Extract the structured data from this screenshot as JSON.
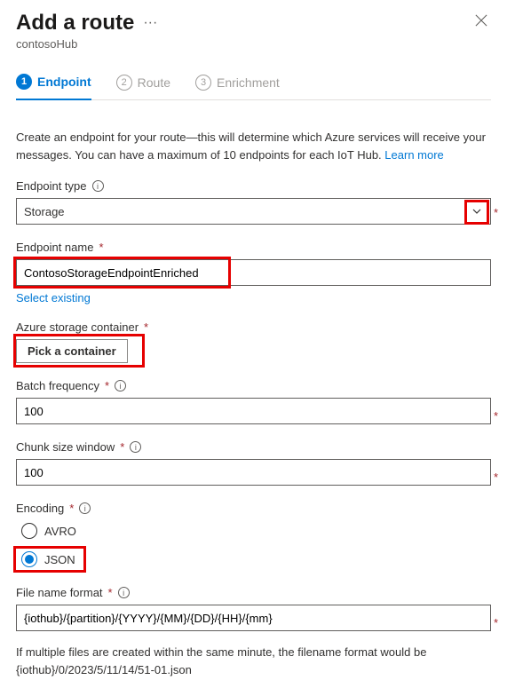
{
  "header": {
    "title": "Add a route",
    "subtitle": "contosoHub"
  },
  "tabs": [
    {
      "num": "1",
      "label": "Endpoint",
      "active": true
    },
    {
      "num": "2",
      "label": "Route",
      "active": false
    },
    {
      "num": "3",
      "label": "Enrichment",
      "active": false
    }
  ],
  "intro": {
    "text": "Create an endpoint for your route—this will determine which Azure services will receive your messages. You can have a maximum of 10 endpoints for each IoT Hub. ",
    "link": "Learn more"
  },
  "fields": {
    "endpointType": {
      "label": "Endpoint type",
      "value": "Storage"
    },
    "endpointName": {
      "label": "Endpoint name",
      "value": "ContosoStorageEndpointEnriched",
      "selectExisting": "Select existing"
    },
    "container": {
      "label": "Azure storage container",
      "button": "Pick a container"
    },
    "batchFreq": {
      "label": "Batch frequency",
      "value": "100"
    },
    "chunkSize": {
      "label": "Chunk size window",
      "value": "100"
    },
    "encoding": {
      "label": "Encoding",
      "options": [
        "AVRO",
        "JSON"
      ],
      "selected": "JSON"
    },
    "fileFormat": {
      "label": "File name format",
      "value": "{iothub}/{partition}/{YYYY}/{MM}/{DD}/{HH}/{mm}"
    }
  },
  "footnote": "If multiple files are created within the same minute, the filename format would be {iothub}/0/2023/5/11/14/51-01.json"
}
